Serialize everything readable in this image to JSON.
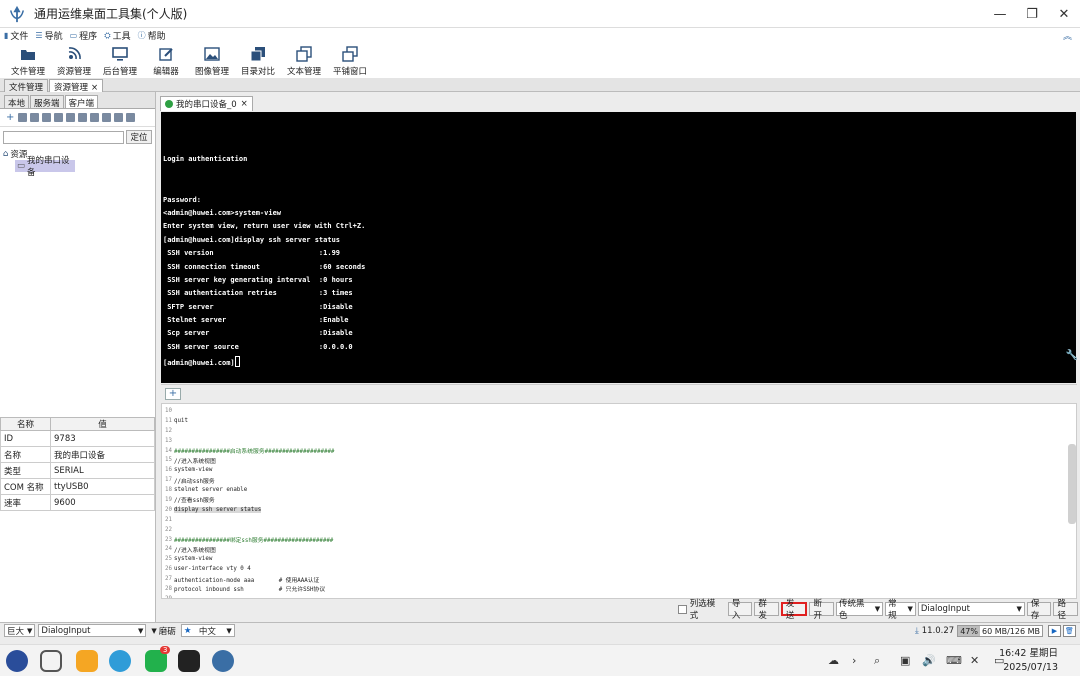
{
  "window": {
    "title": "通用运维桌面工具集(个人版)"
  },
  "menu": [
    "文件",
    "导航",
    "程序",
    "工具",
    "帮助"
  ],
  "toolbar": [
    "文件管理",
    "资源管理",
    "后台管理",
    "编辑器",
    "图像管理",
    "目录对比",
    "文本管理",
    "平铺窗口"
  ],
  "top_tabs": {
    "tab1": "文件管理",
    "tab2": "资源管理",
    "close": "×"
  },
  "left": {
    "tabs": [
      "本地",
      "服务端",
      "客户端"
    ],
    "locate": "定位",
    "tree_root": "资源",
    "tree_child": "我的串口设备",
    "props_header": [
      "名称",
      "值"
    ],
    "props": [
      {
        "k": "ID",
        "v": "9783"
      },
      {
        "k": "名称",
        "v": "我的串口设备"
      },
      {
        "k": "类型",
        "v": "SERIAL"
      },
      {
        "k": "COM 名称",
        "v": "ttyUSB0"
      },
      {
        "k": "速率",
        "v": "9600"
      }
    ]
  },
  "session_tab": {
    "label": "我的串口设备_0",
    "close": "×"
  },
  "terminal": [
    "",
    "Login authentication",
    "",
    "",
    "Password:",
    "<admin@huwei.com>system-view",
    "Enter system view, return user view with Ctrl+Z.",
    "[admin@huwei.com]display ssh server status",
    " SSH version                         :1.99",
    " SSH connection timeout              :60 seconds",
    " SSH server key generating interval  :0 hours",
    " SSH authentication retries          :3 times",
    " SFTP server                         :Disable",
    " Stelnet server                      :Enable",
    " Scp server                          :Disable",
    " SSH server source                   :0.0.0.0",
    "[admin@huwei.com]"
  ],
  "add_label": "+",
  "editor": [
    {
      "n": "10",
      "t": ""
    },
    {
      "n": "11",
      "t": "quit"
    },
    {
      "n": "12",
      "t": ""
    },
    {
      "n": "13",
      "t": ""
    },
    {
      "n": "14",
      "t": "################启动系统服务####################"
    },
    {
      "n": "15",
      "t": "//进入系统视图"
    },
    {
      "n": "16",
      "t": "system-view"
    },
    {
      "n": "17",
      "t": "//启动ssh服务"
    },
    {
      "n": "18",
      "t": "stelnet server enable"
    },
    {
      "n": "19",
      "t": "//查看ssh服务"
    },
    {
      "n": "20",
      "t": "display ssh server status"
    },
    {
      "n": "21",
      "t": ""
    },
    {
      "n": "22",
      "t": ""
    },
    {
      "n": "23",
      "t": "################绑定ssh服务####################"
    },
    {
      "n": "24",
      "t": "//进入系统视图"
    },
    {
      "n": "25",
      "t": "system-view"
    },
    {
      "n": "26",
      "t": "user-interface vty 0 4"
    },
    {
      "n": "27",
      "t": "authentication-mode aaa       # 使用AAA认证"
    },
    {
      "n": "28",
      "t": "protocol inbound ssh          # 只允许SSH协议"
    },
    {
      "n": "29",
      "t": ""
    }
  ],
  "cmdbar": {
    "list_mode": "列选模式",
    "import": "导入",
    "broadcast": "群发",
    "send": "发送",
    "disconnect": "断开",
    "theme": "传统黑色",
    "mode": "常规",
    "dialog": "DialogInput",
    "save": "保存",
    "path": "路径"
  },
  "status": {
    "size": "巨大",
    "font": "DialogInput",
    "style": "磨砺",
    "lang": "中文",
    "version": "11.0.27",
    "mem_pct": "47%",
    "mem": "60 MB/126 MB",
    "mem_fraction": 0.47
  },
  "clock": {
    "time": "16:42 星期日",
    "date": "2025/07/13"
  },
  "taskbar_badge": "3"
}
